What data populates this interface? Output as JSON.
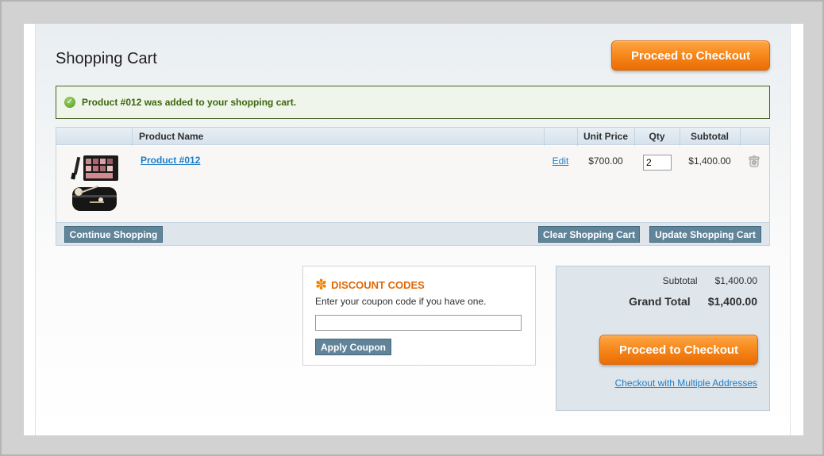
{
  "page": {
    "title": "Shopping Cart",
    "checkout_label": "Proceed to Checkout"
  },
  "message": {
    "success": "Product #012 was added to your shopping cart."
  },
  "cart": {
    "columns": {
      "name": "Product Name",
      "unit_price": "Unit Price",
      "qty": "Qty",
      "subtotal": "Subtotal"
    },
    "items": [
      {
        "name": "Product #012",
        "edit_label": "Edit",
        "unit_price": "$700.00",
        "qty": "2",
        "subtotal": "$1,400.00"
      }
    ],
    "continue_label": "Continue Shopping",
    "clear_label": "Clear Shopping Cart",
    "update_label": "Update Shopping Cart"
  },
  "discount": {
    "title": "Discount Codes",
    "prompt": "Enter your coupon code if you have one.",
    "code_value": "",
    "apply_label": "Apply Coupon"
  },
  "totals": {
    "subtotal_label": "Subtotal",
    "subtotal_value": "$1,400.00",
    "grand_label": "Grand Total",
    "grand_value": "$1,400.00",
    "checkout_label": "Proceed to Checkout",
    "multi_label": "Checkout with Multiple Addresses"
  },
  "icons": {
    "success": "check-circle-icon",
    "discount": "asterisk-icon",
    "remove": "trash-icon"
  },
  "colors": {
    "checkout": "#f78a1c",
    "grey_button": "#618499",
    "link": "#1e7ec8",
    "success_text": "#3d6611",
    "discount_title": "#e26703"
  }
}
